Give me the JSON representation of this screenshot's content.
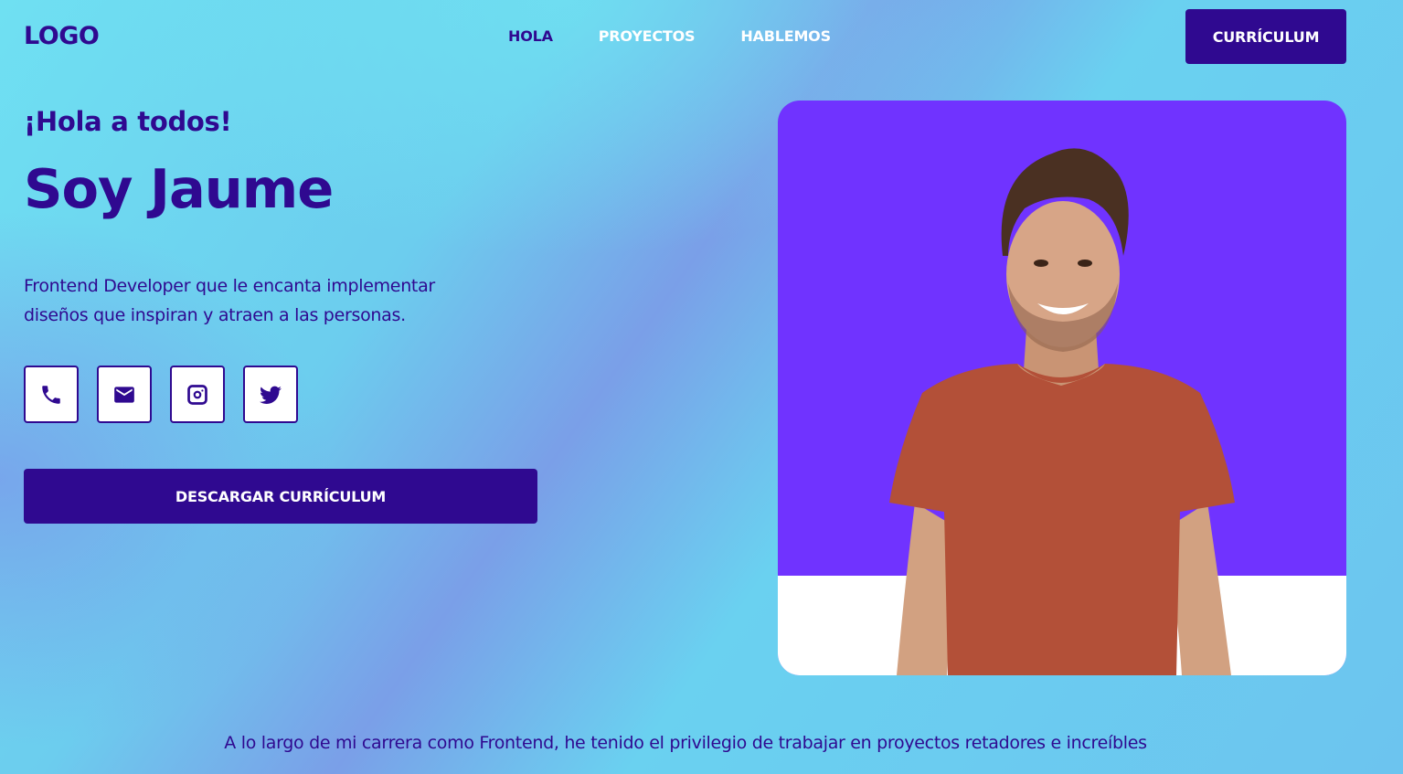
{
  "header": {
    "logo": "LOGO",
    "nav": [
      {
        "label": "HOLA"
      },
      {
        "label": "PROYECTOS"
      },
      {
        "label": "HABLEMOS"
      }
    ],
    "cv_button": "CURRÍCULUM"
  },
  "hero": {
    "greeting": "¡Hola a todos!",
    "name": "Soy Jaume",
    "description_line1": "Frontend Developer que le encanta implementar",
    "description_line2": "diseños que inspiran y atraen a las personas.",
    "socials": [
      {
        "icon": "phone-icon"
      },
      {
        "icon": "mail-icon"
      },
      {
        "icon": "instagram-icon"
      },
      {
        "icon": "twitter-icon"
      }
    ],
    "download_button": "DESCARGAR CURRÍCULUM"
  },
  "photo": {
    "background_color": "#7033ff"
  },
  "about": {
    "text": "A lo largo de mi carrera como Frontend, he tenido el privilegio de trabajar en proyectos retadores e increíbles"
  },
  "colors": {
    "primary": "#2f0990",
    "accent": "#7033ff",
    "white": "#ffffff"
  }
}
